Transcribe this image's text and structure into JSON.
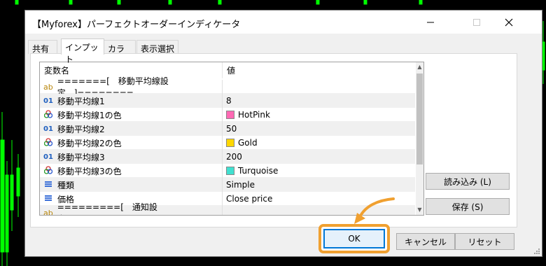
{
  "window": {
    "title": "【Myforex】パーフェクトオーダーインディケータ",
    "minimize_icon": "minimize-icon",
    "maximize_icon": "maximize-icon",
    "close_icon": "close-icon"
  },
  "tabs": [
    {
      "label": "共有",
      "active": false
    },
    {
      "label": "インプット",
      "active": true
    },
    {
      "label": "カラー",
      "active": false
    },
    {
      "label": "表示選択",
      "active": false
    }
  ],
  "grid": {
    "header": {
      "col1": "変数名",
      "col2": "値"
    },
    "rows": [
      {
        "icon": "ab",
        "icon_color": "#b8860b",
        "name": "=======[　移動平均線設定　]========",
        "value": "",
        "color": null
      },
      {
        "icon": "01",
        "icon_color": "#1f5fbf",
        "name": "移動平均線1",
        "value": "8",
        "color": null
      },
      {
        "icon": "palette",
        "icon_color": "#cc3333",
        "name": "移動平均線1の色",
        "value": "HotPink",
        "color": "#ff69b4"
      },
      {
        "icon": "01",
        "icon_color": "#1f5fbf",
        "name": "移動平均線2",
        "value": "50",
        "color": null
      },
      {
        "icon": "palette",
        "icon_color": "#cc3333",
        "name": "移動平均線2の色",
        "value": "Gold",
        "color": "#ffd700"
      },
      {
        "icon": "01",
        "icon_color": "#1f5fbf",
        "name": "移動平均線3",
        "value": "200",
        "color": null
      },
      {
        "icon": "palette",
        "icon_color": "#cc3333",
        "name": "移動平均線3の色",
        "value": "Turquoise",
        "color": "#40e0d0"
      },
      {
        "icon": "list",
        "icon_color": "#3a6fd8",
        "name": "種類",
        "value": "Simple",
        "color": null
      },
      {
        "icon": "list",
        "icon_color": "#3a6fd8",
        "name": "価格",
        "value": "Close price",
        "color": null
      },
      {
        "icon": "ab",
        "icon_color": "#b8860b",
        "name": "=========[　通知設定　]==========",
        "value": "",
        "color": null
      }
    ]
  },
  "side_buttons": {
    "load": "読み込み (L)",
    "save": "保存 (S)"
  },
  "footer_buttons": {
    "ok": "OK",
    "cancel": "キャンセル",
    "reset": "リセット"
  },
  "colors": {
    "highlight": "#f0a030",
    "ok_border": "#0078d7"
  }
}
